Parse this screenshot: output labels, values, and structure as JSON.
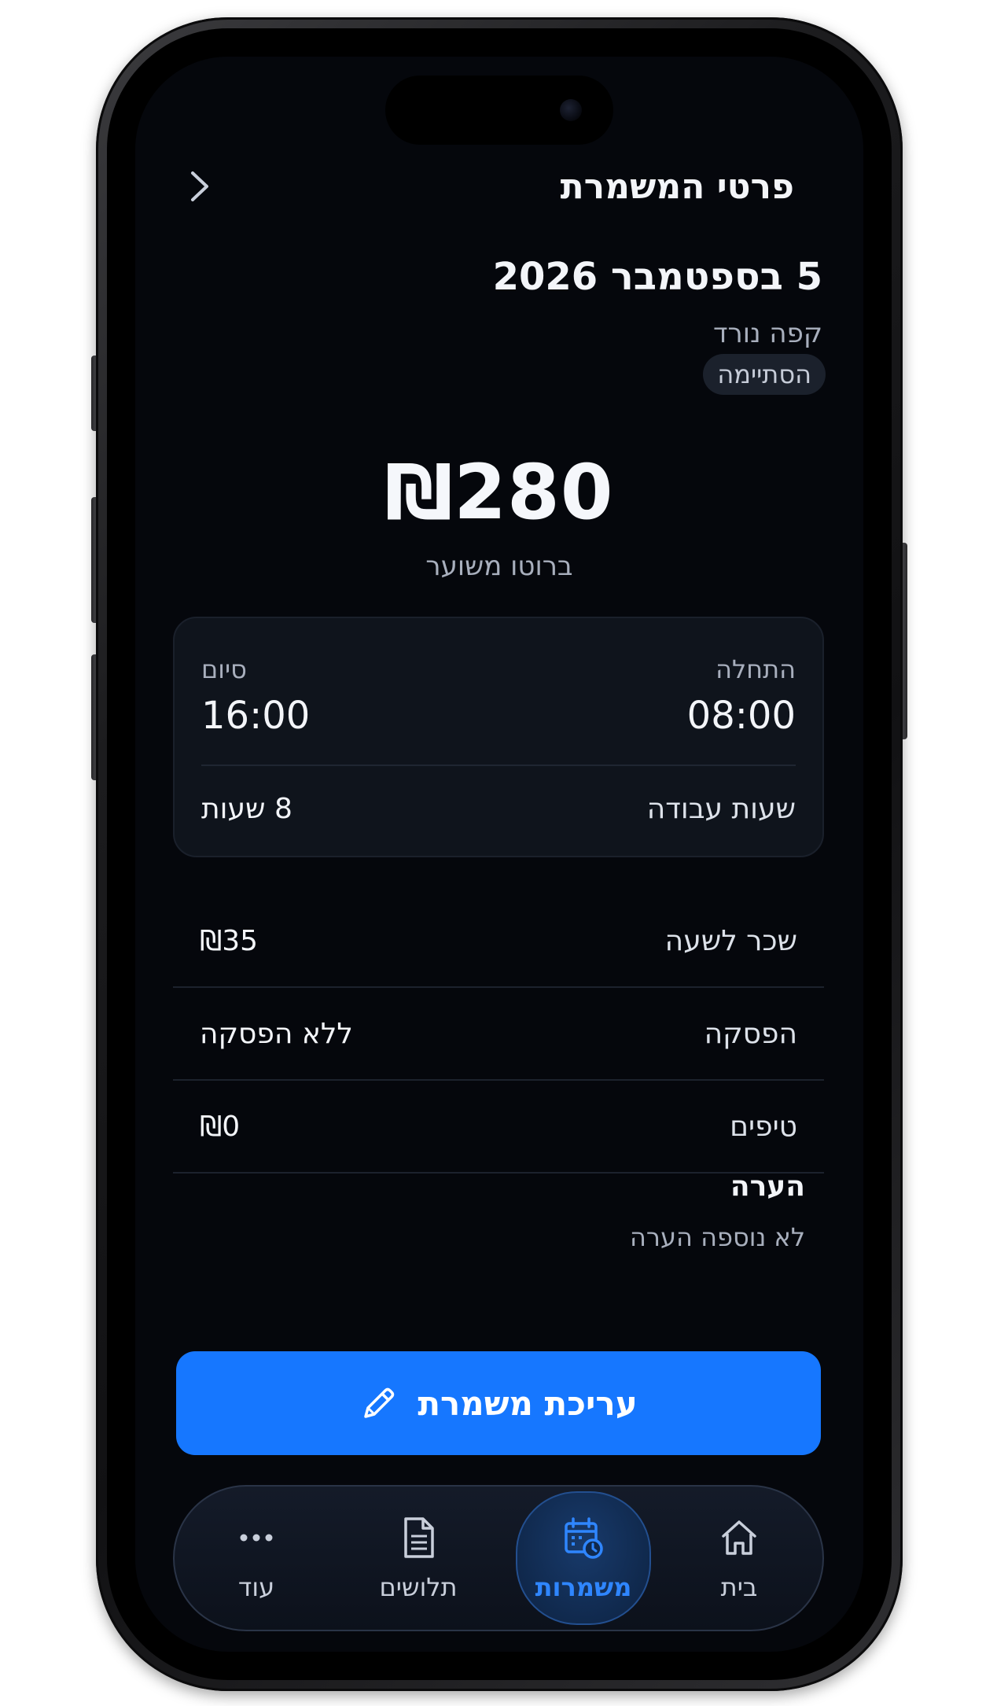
{
  "header": {
    "title": "פרטי המשמרת"
  },
  "shift": {
    "date": "5 בספטמבר 2026",
    "workplace": "קפה נורד",
    "status": "הסתיימה",
    "amount": "₪280",
    "amount_label": "ברוטו משוער"
  },
  "time_card": {
    "start_label": "התחלה",
    "start_value": "08:00",
    "end_label": "סיום",
    "end_value": "16:00",
    "hours_label": "שעות עבודה",
    "hours_value": "8 שעות"
  },
  "details": [
    {
      "label": "שכר לשעה",
      "value": "₪35"
    },
    {
      "label": "הפסקה",
      "value": "ללא הפסקה"
    },
    {
      "label": "טיפים",
      "value": "₪0"
    }
  ],
  "note": {
    "title": "הערה",
    "text": "לא נוספה הערה"
  },
  "edit_button": {
    "label": "עריכת משמרת"
  },
  "tabbar": {
    "items": [
      {
        "label": "בית",
        "icon": "home-icon"
      },
      {
        "label": "משמרות",
        "icon": "calendar-clock-icon",
        "active": true
      },
      {
        "label": "תלושים",
        "icon": "document-icon"
      },
      {
        "label": "עוד",
        "icon": "more-icon"
      }
    ]
  },
  "colors": {
    "accent": "#1677ff",
    "background": "#05070c",
    "card": "#0f141c"
  }
}
